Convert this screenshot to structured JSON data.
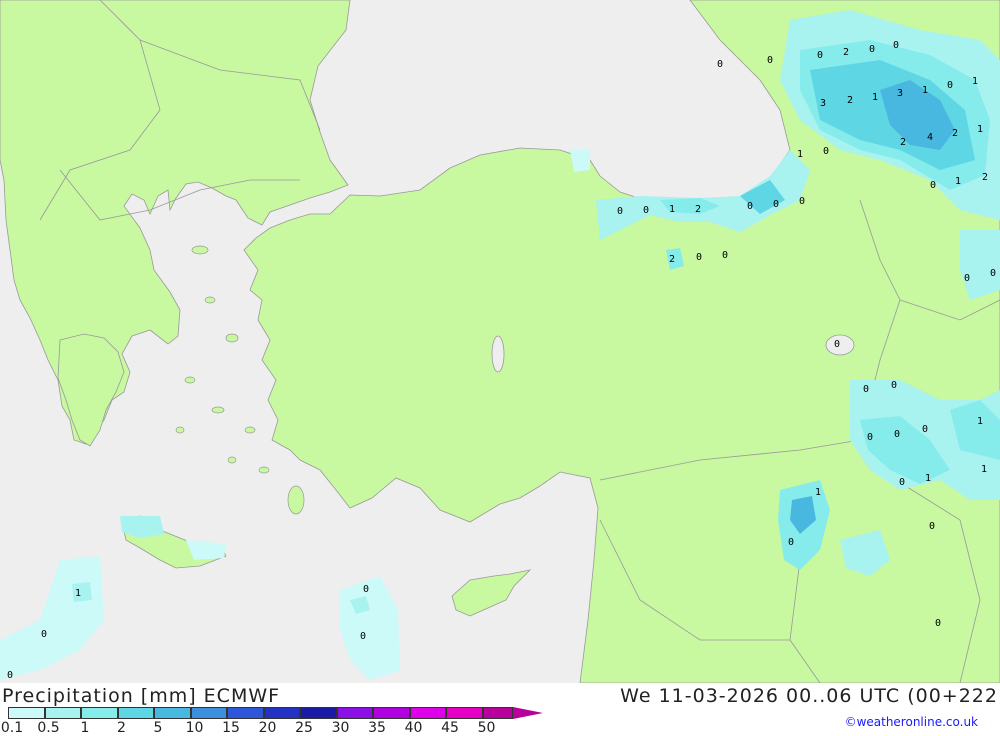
{
  "title": "Precipitation [mm] ECMWF",
  "datetime": "We 11-03-2026 00..06 UTC (00+222",
  "credit": "©weatheronline.co.uk",
  "colors": {
    "sea": "#eeeeee",
    "land": "#c8f8a0",
    "border": "#999999"
  },
  "legend": {
    "labels": [
      "0.1",
      "0.5",
      "1",
      "2",
      "5",
      "10",
      "15",
      "20",
      "25",
      "30",
      "35",
      "40",
      "45",
      "50"
    ],
    "colors": [
      "#ccfaf8",
      "#a8f2f0",
      "#86eceb",
      "#5fd6e4",
      "#49b8e0",
      "#3c8fdc",
      "#2d56d8",
      "#2432c4",
      "#1c1ba8",
      "#8a10e6",
      "#b000e0",
      "#dd00e8",
      "#e600c4",
      "#b8009c"
    ]
  },
  "markers": [
    {
      "v": "0"
    },
    {
      "v": "0"
    },
    {
      "v": "0"
    },
    {
      "v": "2"
    },
    {
      "v": "0"
    },
    {
      "v": "0"
    },
    {
      "v": "3"
    },
    {
      "v": "2"
    },
    {
      "v": "1"
    },
    {
      "v": "3"
    },
    {
      "v": "1"
    },
    {
      "v": "0"
    },
    {
      "v": "1"
    },
    {
      "v": "2"
    },
    {
      "v": "4"
    },
    {
      "v": "2"
    },
    {
      "v": "1"
    },
    {
      "v": "1"
    },
    {
      "v": "0"
    },
    {
      "v": "0"
    },
    {
      "v": "1"
    },
    {
      "v": "2"
    },
    {
      "v": "0"
    },
    {
      "v": "0"
    },
    {
      "v": "1"
    },
    {
      "v": "2"
    },
    {
      "v": "0"
    },
    {
      "v": "0"
    },
    {
      "v": "0"
    },
    {
      "v": "2"
    },
    {
      "v": "0"
    },
    {
      "v": "0"
    },
    {
      "v": "0"
    },
    {
      "v": "0"
    },
    {
      "v": "0"
    },
    {
      "v": "0"
    },
    {
      "v": "0"
    },
    {
      "v": "0"
    },
    {
      "v": "0"
    },
    {
      "v": "0"
    },
    {
      "v": "1"
    },
    {
      "v": "0"
    },
    {
      "v": "1"
    },
    {
      "v": "1"
    },
    {
      "v": "1"
    },
    {
      "v": "0"
    },
    {
      "v": "0"
    },
    {
      "v": "0"
    },
    {
      "v": "0"
    },
    {
      "v": "0"
    },
    {
      "v": "1"
    },
    {
      "v": "0"
    },
    {
      "v": "0"
    }
  ]
}
